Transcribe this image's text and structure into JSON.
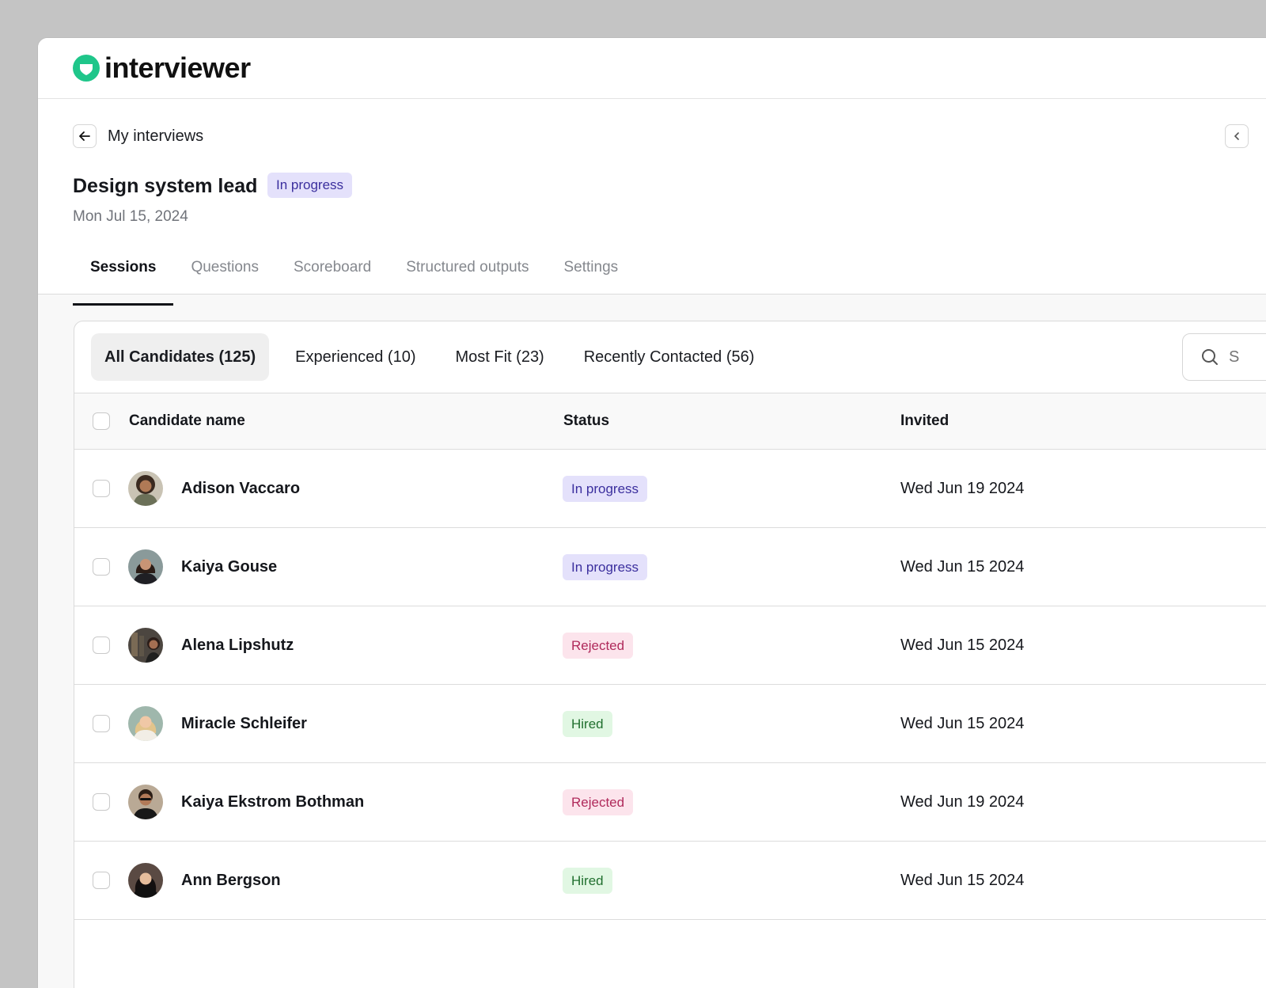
{
  "brand": {
    "name": "interviewer",
    "accent": "#1fc68a"
  },
  "nav": {
    "back_label": "My interviews"
  },
  "interview": {
    "title": "Design system lead",
    "status": "In progress",
    "date": "Mon Jul 15, 2024"
  },
  "tabs": [
    {
      "label": "Sessions",
      "active": true
    },
    {
      "label": "Questions",
      "active": false
    },
    {
      "label": "Scoreboard",
      "active": false
    },
    {
      "label": "Structured outputs",
      "active": false
    },
    {
      "label": "Settings",
      "active": false
    }
  ],
  "filters": [
    {
      "label": "All Candidates (125)",
      "active": true
    },
    {
      "label": "Experienced (10)",
      "active": false
    },
    {
      "label": "Most Fit (23)",
      "active": false
    },
    {
      "label": "Recently Contacted (56)",
      "active": false
    }
  ],
  "search": {
    "placeholder": "S"
  },
  "table": {
    "columns": [
      "Candidate name",
      "Status",
      "Invited"
    ],
    "rows": [
      {
        "name": "Adison Vaccaro",
        "status": "In progress",
        "status_kind": "progress",
        "invited": "Wed Jun 19 2024"
      },
      {
        "name": "Kaiya Gouse",
        "status": "In progress",
        "status_kind": "progress",
        "invited": "Wed Jun 15 2024"
      },
      {
        "name": "Alena Lipshutz",
        "status": "Rejected",
        "status_kind": "rejected",
        "invited": "Wed Jun 15 2024"
      },
      {
        "name": "Miracle Schleifer",
        "status": "Hired",
        "status_kind": "hired",
        "invited": "Wed Jun 15 2024"
      },
      {
        "name": "Kaiya Ekstrom Bothman",
        "status": "Rejected",
        "status_kind": "rejected",
        "invited": "Wed Jun 19 2024"
      },
      {
        "name": "Ann Bergson",
        "status": "Hired",
        "status_kind": "hired",
        "invited": "Wed Jun 15 2024"
      }
    ]
  },
  "colors": {
    "progress_bg": "#e4e1fb",
    "progress_fg": "#3b2f9e",
    "rejected_bg": "#fce4ec",
    "rejected_fg": "#b02a5b",
    "hired_bg": "#e1f7e3",
    "hired_fg": "#21702f"
  }
}
